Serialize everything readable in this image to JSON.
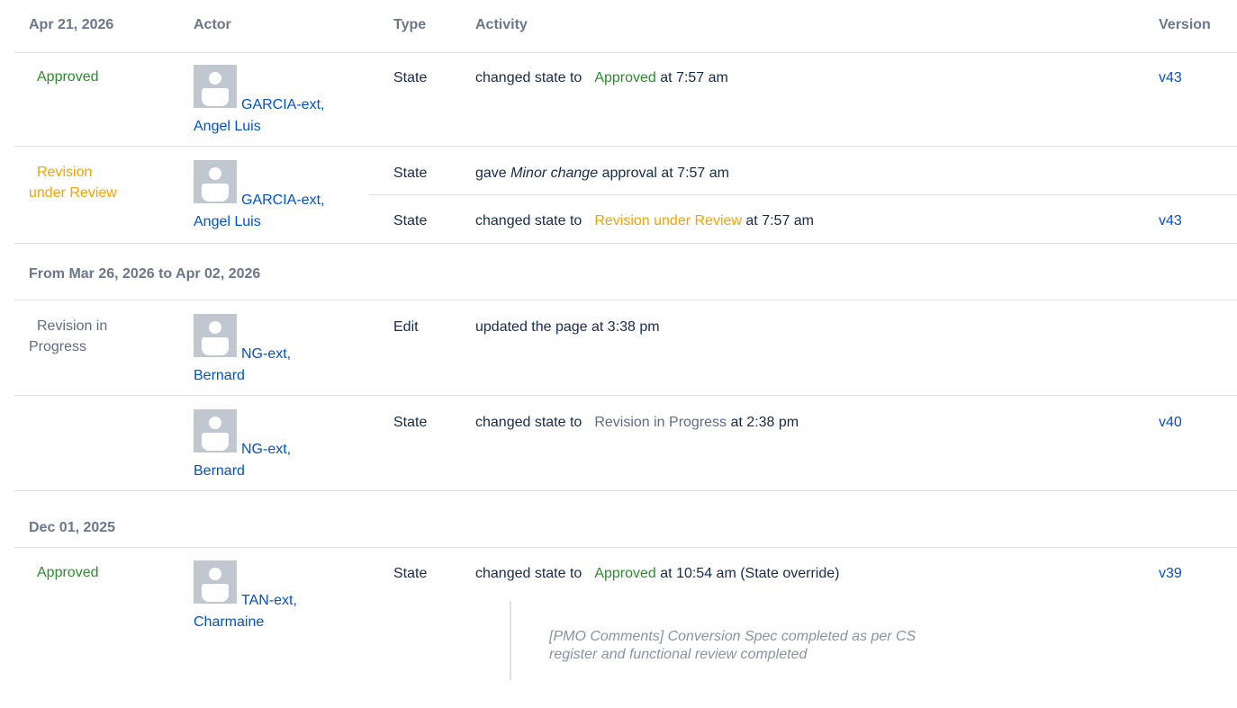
{
  "header": {
    "date": "Apr 21, 2026",
    "actor": "Actor",
    "type": "Type",
    "activity": "Activity",
    "version": "Version"
  },
  "groups": [
    {
      "label": "From Mar 26, 2026 to Apr 02, 2026"
    },
    {
      "label": "Dec 01, 2025"
    }
  ],
  "rows": [
    {
      "state": "Approved",
      "actor_l1": "GARCIA-ext,",
      "actor_l2": "Angel Luis",
      "entries": [
        {
          "type": "State",
          "prefix": "changed state to",
          "label": "Approved",
          "suffix": "at 7:57 am",
          "version": "v43"
        }
      ]
    },
    {
      "state_l1": "Revision",
      "state_l2": "under Review",
      "actor_l1": "GARCIA-ext,",
      "actor_l2": "Angel Luis",
      "entries": [
        {
          "type": "State",
          "prefix": "gave",
          "emph": "Minor change",
          "suffix": "approval at 7:57 am"
        },
        {
          "type": "State",
          "prefix": "changed state to",
          "label": "Revision under Review",
          "suffix": "at 7:57 am",
          "version": "v43"
        }
      ]
    },
    {
      "state_l1": "Revision in",
      "state_l2": "Progress",
      "actor_l1": "NG-ext,",
      "actor_l2": "Bernard",
      "entries": [
        {
          "type": "Edit",
          "text": "updated the page at 3:38 pm"
        }
      ]
    },
    {
      "actor_l1": "NG-ext,",
      "actor_l2": "Bernard",
      "entries": [
        {
          "type": "State",
          "prefix": "changed state to",
          "label": "Revision in Progress",
          "suffix": "at 2:38 pm",
          "version": "v40"
        }
      ]
    },
    {
      "state": "Approved",
      "actor_l1": "TAN-ext,",
      "actor_l2": "Charmaine",
      "entries": [
        {
          "type": "State",
          "prefix": "changed state to",
          "label": "Approved",
          "suffix": "at 10:54 am (State override)",
          "version": "v39"
        }
      ],
      "comment_l1": "[PMO Comments] Conversion Spec completed as per CS",
      "comment_l2": "register and functional review completed"
    }
  ],
  "colors": {
    "approved": "#2e8b2e",
    "review": "#f5a300",
    "progress": "#5e6c84",
    "link": "#0052cc"
  },
  "icons": {
    "avatar": "default-avatar-icon"
  }
}
